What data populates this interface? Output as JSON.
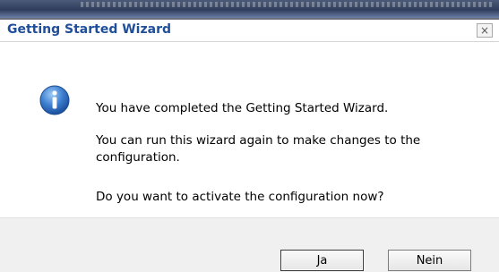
{
  "dialog": {
    "title": "Getting Started Wizard",
    "close_glyph": "×",
    "icon": "info-icon",
    "messages": [
      "You have completed the Getting Started Wizard.",
      "You can run this wizard again to make changes to the",
      "configuration.",
      "Do you want to activate the configuration now?"
    ],
    "buttons": {
      "yes_label": "Ja",
      "no_label": "Nein"
    }
  },
  "colors": {
    "title": "#1f4e9a",
    "info_icon": "#2f6fb7"
  }
}
